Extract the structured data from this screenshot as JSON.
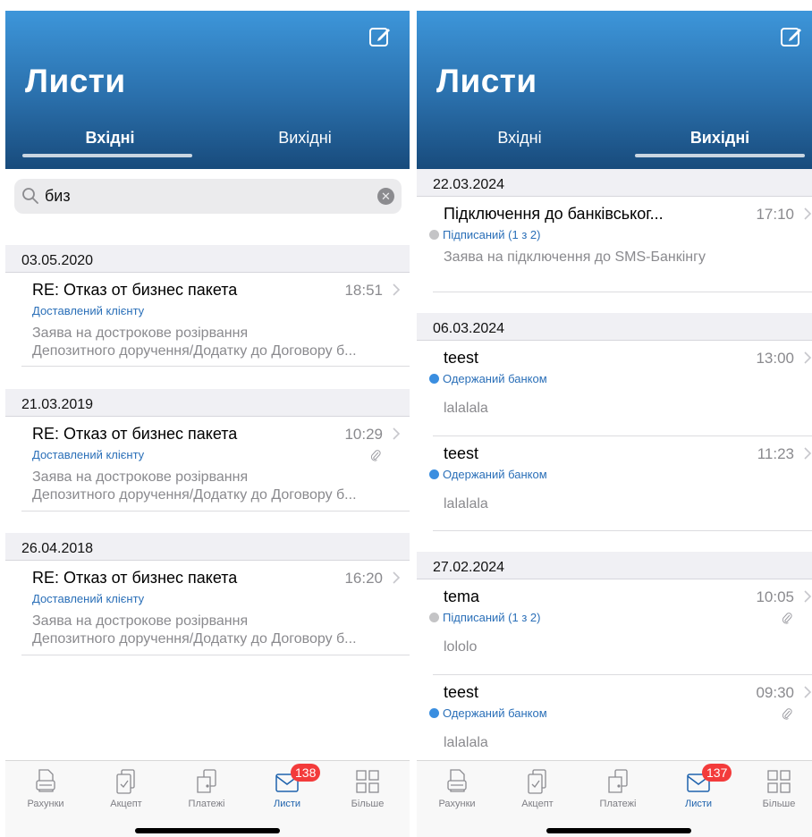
{
  "left": {
    "title": "Листи",
    "tabs": [
      {
        "label": "Вхідні",
        "active": true
      },
      {
        "label": "Вихідні",
        "active": false
      }
    ],
    "search": {
      "value": "биз"
    },
    "groups": [
      {
        "date": "03.05.2020",
        "items": [
          {
            "subject": "RE: Отказ от бизнес пакета",
            "time": "18:51",
            "status": "Доставлений клієнту",
            "body_line1": "Заява на дострокове розірвання",
            "body_line2": "Депозитного доручення/Додатку до Договору б...",
            "attachment": false
          }
        ]
      },
      {
        "date": "21.03.2019",
        "items": [
          {
            "subject": "RE: Отказ от бизнес пакета",
            "time": "10:29",
            "status": "Доставлений клієнту",
            "body_line1": "Заява на дострокове розірвання",
            "body_line2": "Депозитного доручення/Додатку до Договору б...",
            "attachment": true
          }
        ]
      },
      {
        "date": "26.04.2018",
        "items": [
          {
            "subject": "RE: Отказ от бизнес пакета",
            "time": "16:20",
            "status": "Доставлений клієнту",
            "body_line1": "Заява на дострокове розірвання",
            "body_line2": "Депозитного доручення/Додатку до Договору б...",
            "attachment": false
          }
        ]
      }
    ],
    "tabbar": {
      "items": [
        "Рахунки",
        "Акцепт",
        "Платежі",
        "Листи",
        "Більше"
      ],
      "active_index": 3,
      "badge": "138"
    }
  },
  "right": {
    "title": "Листи",
    "tabs": [
      {
        "label": "Вхідні",
        "active": false
      },
      {
        "label": "Вихідні",
        "active": true
      }
    ],
    "groups": [
      {
        "date": "22.03.2024",
        "items": [
          {
            "subject": "Підключення до банківськог...",
            "time": "17:10",
            "status": "Підписаний (1 з 2)",
            "status_dot": "grey",
            "body": "Заява на підключення до SMS-Банкінгу",
            "attachment": false
          }
        ]
      },
      {
        "date": "06.03.2024",
        "items": [
          {
            "subject": "teest",
            "time": "13:00",
            "status": "Одержаний банком",
            "status_dot": "blue",
            "body": "lalalala",
            "attachment": false
          },
          {
            "subject": "teest",
            "time": "11:23",
            "status": "Одержаний банком",
            "status_dot": "blue",
            "body": "lalalala",
            "attachment": false
          }
        ]
      },
      {
        "date": "27.02.2024",
        "items": [
          {
            "subject": "tema",
            "time": "10:05",
            "status": "Підписаний (1 з 2)",
            "status_dot": "grey",
            "body": "lololo",
            "attachment": true
          },
          {
            "subject": "teest",
            "time": "09:30",
            "status": "Одержаний банком",
            "status_dot": "blue",
            "body": "lalalala",
            "attachment": true
          }
        ]
      }
    ],
    "tabbar": {
      "items": [
        "Рахунки",
        "Акцепт",
        "Платежі",
        "Листи",
        "Більше"
      ],
      "active_index": 3,
      "badge": "137"
    }
  },
  "colors": {
    "header_top": "#3d96da",
    "header_bottom": "#184b7c",
    "status_blue": "#2a6fb8",
    "dot_blue": "#3a8ee0",
    "dot_grey": "#c4c4c6",
    "badge_red": "#f33b3b",
    "active_tab": "#1f63ad"
  },
  "icons": [
    "compose-icon",
    "search-icon",
    "clear-icon",
    "chevron-right-icon",
    "paperclip-icon",
    "accounts-icon",
    "accept-icon",
    "payments-icon",
    "mail-icon",
    "more-grid-icon"
  ]
}
